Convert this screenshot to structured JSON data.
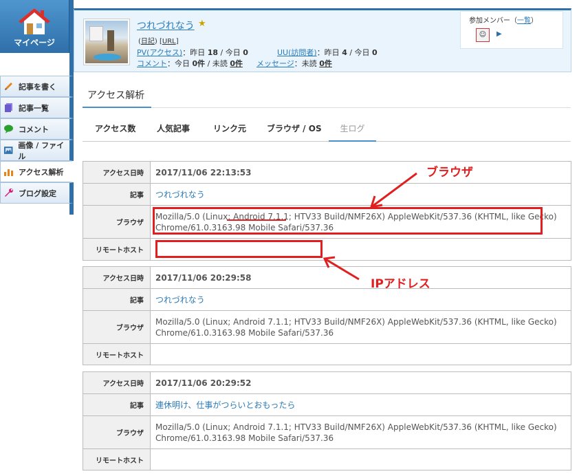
{
  "sidebar": {
    "mypage_label": "マイページ",
    "items": [
      {
        "label": "記事を書く",
        "icon": "pencil-icon",
        "color": "#e8841c"
      },
      {
        "label": "記事一覧",
        "icon": "documents-icon",
        "color": "#6a5acd"
      },
      {
        "label": "コメント",
        "icon": "speech-bubble-icon",
        "color": "#2ca02c"
      },
      {
        "label": "画像 / ファイル",
        "icon": "image-icon",
        "color": "#2f6faa"
      },
      {
        "label": "アクセス解析",
        "icon": "bar-chart-icon",
        "color": "#e8841c"
      },
      {
        "label": "ブログ設定",
        "icon": "wrench-icon",
        "color": "#d81b7a"
      }
    ]
  },
  "profile": {
    "blog_title": "つれづれなう",
    "diary_link": "日記",
    "url_link": "URL",
    "pv_label": "PV(アクセス)",
    "pv_stats_prefix": "：昨日",
    "pv_yesterday": "18",
    "pv_stats_mid": "/ 今日",
    "pv_today": "0",
    "uu_label": "UU(訪問者)",
    "uu_stats_prefix": "：昨日",
    "uu_yesterday": "4",
    "uu_stats_mid": "/ 今日",
    "uu_today": "0",
    "comment_label": "コメント",
    "comment_prefix": "：今日",
    "comment_today": "0件",
    "comment_mid": "/ 未読",
    "comment_unread": "0件",
    "message_label": "メッセージ",
    "message_prefix": "：未読",
    "message_unread": "0件",
    "members_label": "参加メンバー",
    "members_link": "一覧"
  },
  "section_title": "アクセス解析",
  "tabs": [
    "アクセス数",
    "人気記事",
    "リンク元",
    "ブラウザ / OS",
    "生ログ"
  ],
  "row_labels": {
    "datetime": "アクセス日時",
    "article": "記事",
    "browser": "ブラウザ",
    "remote_host": "リモートホスト"
  },
  "logs": [
    {
      "datetime": "2017/11/06 22:13:53",
      "article": "つれづれなう",
      "ua_line1_a": "Mozilla/5.0 (Linux; ",
      "ua_line1_b": "Android 7.1.1;",
      "ua_line1_c": " HTV33 Build/NMF26X) AppleWebKit/537.36 (KHTML, like Gecko)",
      "ua_line2": "Chrome/61.0.3163.98 Mobile Safari/537.36",
      "remote_host": ""
    },
    {
      "datetime": "2017/11/06 20:29:58",
      "article": "つれづれなう",
      "ua_line1": "Mozilla/5.0 (Linux; Android 7.1.1; HTV33 Build/NMF26X) AppleWebKit/537.36 (KHTML, like Gecko)",
      "ua_line2": "Chrome/61.0.3163.98 Mobile Safari/537.36",
      "remote_host": ""
    },
    {
      "datetime": "2017/11/06 20:29:52",
      "article": "連休明け、仕事がつらいとおもったら",
      "ua_line1": "Mozilla/5.0 (Linux; Android 7.1.1; HTV33 Build/NMF26X) AppleWebKit/537.36 (KHTML, like Gecko)",
      "ua_line2": "Chrome/61.0.3163.98 Mobile Safari/537.36",
      "remote_host": ""
    }
  ],
  "annotations": {
    "browser_label": "ブラウザ",
    "ip_label": "IPアドレス",
    "color": "#e02020"
  }
}
